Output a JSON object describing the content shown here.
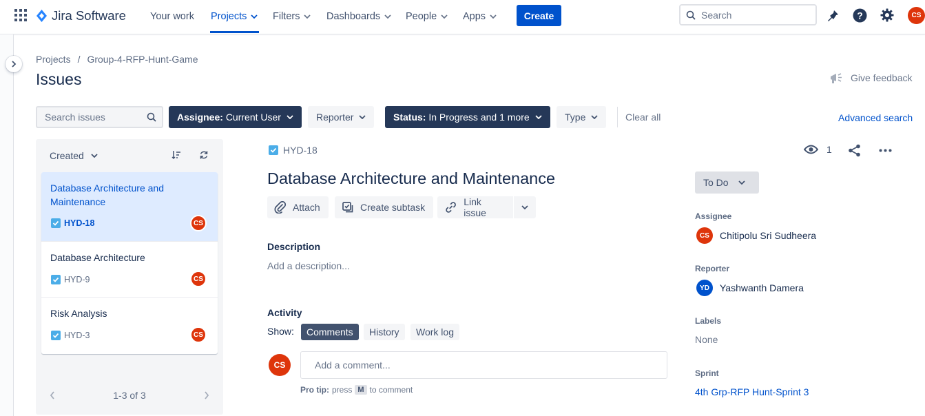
{
  "colors": {
    "accent": "#0052cc",
    "dark_filter": "#253858",
    "avatar_cs": "#de350b",
    "avatar_yd": "#0052cc"
  },
  "nav": {
    "product_name": "Jira Software",
    "items": [
      {
        "label": "Your work"
      },
      {
        "label": "Projects"
      },
      {
        "label": "Filters"
      },
      {
        "label": "Dashboards"
      },
      {
        "label": "People"
      },
      {
        "label": "Apps"
      }
    ],
    "create_label": "Create",
    "search_placeholder": "Search",
    "user_initials": "CS"
  },
  "breadcrumb": {
    "root": "Projects",
    "separator": "/",
    "project": "Group-4-RFP-Hunt-Game"
  },
  "page_title": "Issues",
  "give_feedback": "Give feedback",
  "filters": {
    "search_placeholder": "Search issues",
    "assignee_key": "Assignee:",
    "assignee_value": "Current User",
    "reporter": "Reporter",
    "status_key": "Status:",
    "status_value": "In Progress and 1 more",
    "type": "Type",
    "clear_all": "Clear all",
    "advanced_search": "Advanced search"
  },
  "list": {
    "sort_label": "Created",
    "issues": [
      {
        "title": "Database Architecture and Maintenance",
        "key": "HYD-18",
        "avatar": "CS"
      },
      {
        "title": "Database Architecture",
        "key": "HYD-9",
        "avatar": "CS"
      },
      {
        "title": "Risk Analysis",
        "key": "HYD-3",
        "avatar": "CS"
      }
    ],
    "pagination": "1-3 of 3"
  },
  "issue": {
    "key": "HYD-18",
    "title": "Database Architecture and Maintenance",
    "watchers": "1",
    "actions": {
      "attach": "Attach",
      "create_subtask": "Create subtask",
      "link_issue": "Link issue"
    },
    "description_label": "Description",
    "description_placeholder": "Add a description...",
    "activity_label": "Activity",
    "show_label": "Show:",
    "tabs": {
      "comments": "Comments",
      "history": "History",
      "work_log": "Work log"
    },
    "comment_placeholder": "Add a comment...",
    "commenter_initials": "CS",
    "protip": {
      "prefix": "Pro tip:",
      "press": "press",
      "key": "M",
      "suffix": "to comment"
    },
    "status": "To Do",
    "assignee_label": "Assignee",
    "assignee": {
      "initials": "CS",
      "name": "Chitipolu Sri Sudheera"
    },
    "reporter_label": "Reporter",
    "reporter": {
      "initials": "YD",
      "name": "Yashwanth Damera"
    },
    "labels_label": "Labels",
    "labels_value": "None",
    "sprint_label": "Sprint",
    "sprint_value": "4th Grp-RFP Hunt-Sprint 3"
  }
}
